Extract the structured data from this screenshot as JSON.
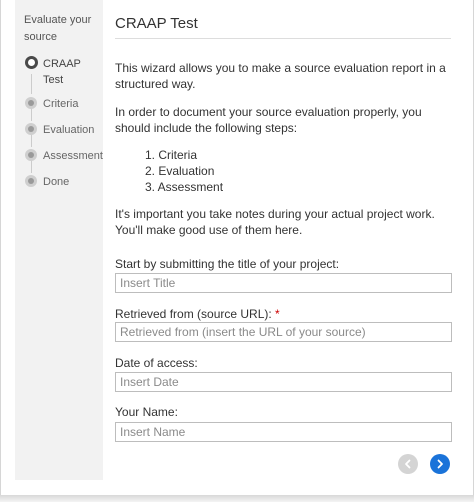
{
  "sidebar": {
    "title": "Evaluate your source",
    "steps": [
      {
        "label": "CRAAP Test",
        "active": true
      },
      {
        "label": "Criteria",
        "active": false
      },
      {
        "label": "Evaluation",
        "active": false
      },
      {
        "label": "Assessment",
        "active": false
      },
      {
        "label": "Done",
        "active": false
      }
    ]
  },
  "main": {
    "title": "CRAAP Test",
    "intro": "This wizard allows you to make a source evaluation report in a structured way.",
    "instructions": "In order to document your source evaluation properly, you should include the following steps:",
    "list": [
      "1. Criteria",
      "2. Evaluation",
      "3. Assessment"
    ],
    "notes": "It's important you take notes during your actual project work. You'll make good use of them here.",
    "fields": [
      {
        "label": "Start by submitting the title of your project:",
        "placeholder": "Insert Title",
        "value": "",
        "required": false
      },
      {
        "label": "Retrieved from (source URL): ",
        "placeholder": "Retrieved from (insert the URL of your source)",
        "value": "",
        "required": true,
        "required_mark": "*"
      },
      {
        "label": "Date of access:",
        "placeholder": "Insert Date",
        "value": "",
        "required": false
      },
      {
        "label": "Your Name:",
        "placeholder": "Insert Name",
        "value": "",
        "required": false
      }
    ]
  },
  "nav": {
    "prev_icon": "chevron-left-icon",
    "next_icon": "chevron-right-icon",
    "prev_enabled": false,
    "next_color": "#1a73d9"
  }
}
